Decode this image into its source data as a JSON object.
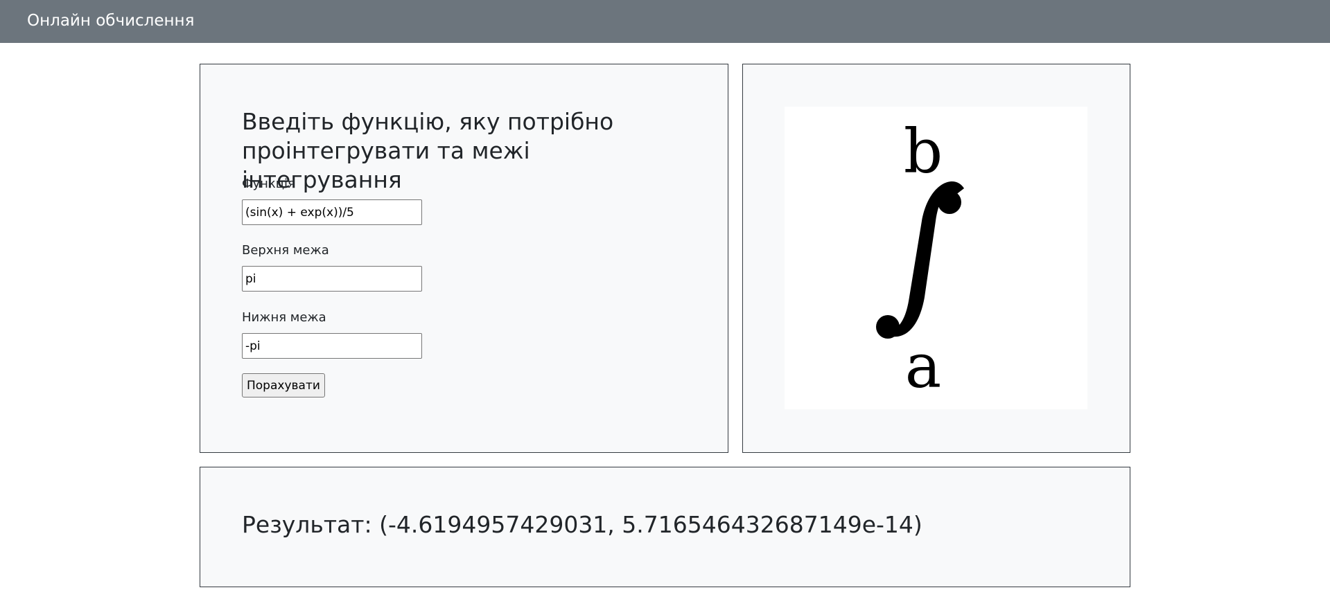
{
  "navbar": {
    "brand": "Онлайн обчислення"
  },
  "form": {
    "title": "Введіть функцію, яку потрібно проінтегрувати та межі інтегрування",
    "function_label": "Функція",
    "function_value": "(sin(x) + exp(x))/5",
    "upper_label": "Верхня межа",
    "upper_value": "pi",
    "lower_label": "Нижня межа",
    "lower_value": "-pi",
    "submit_label": "Порахувати"
  },
  "image": {
    "upper_letter": "b",
    "lower_letter": "a"
  },
  "result": {
    "text": "Результат: (-4.6194957429031, 5.716546432687149e-14)"
  }
}
